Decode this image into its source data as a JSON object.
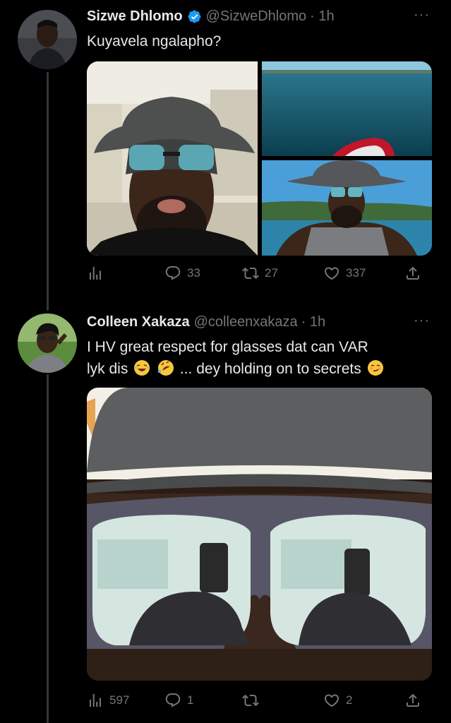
{
  "tweet1": {
    "display_name": "Sizwe Dhlomo",
    "handle": "@SizweDhlomo",
    "time": "· 1h",
    "more": "···",
    "text": "Kuyavela ngalapho?",
    "replies": "33",
    "retweets": "27",
    "likes": "337",
    "views": ""
  },
  "tweet2": {
    "display_name": "Colleen Xakaza",
    "handle": "@colleenxakaza",
    "time": "· 1h",
    "more": "···",
    "text_line1": "I HV great respect for glasses dat can VAR",
    "text_line2a": "lyk dis",
    "text_line2b": "... dey holding on to secrets",
    "views": "597",
    "replies": "1",
    "retweets": "",
    "likes": "2"
  },
  "colors": {
    "background": "#000000",
    "text": "#e7e9ea",
    "muted": "#71767b",
    "verified": "#1d9bf0"
  },
  "icons": [
    "verified-badge-icon",
    "more-icon",
    "views-icon",
    "reply-icon",
    "retweet-icon",
    "like-icon",
    "share-icon",
    "laughing-emoji",
    "rofl-emoji",
    "smirk-emoji"
  ]
}
